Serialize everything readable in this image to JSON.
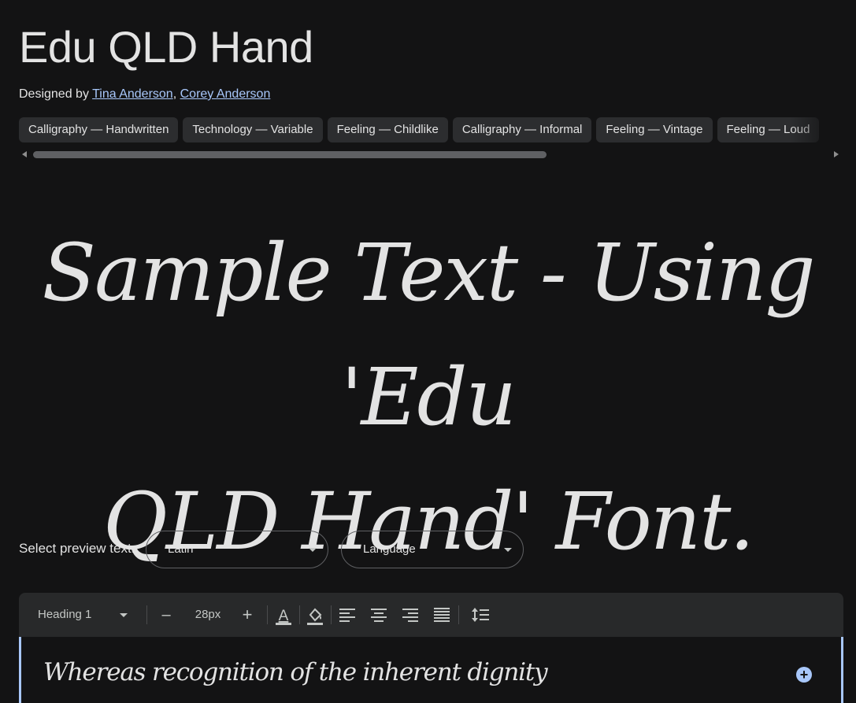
{
  "font": {
    "name": "Edu QLD Hand",
    "designed_by_label": "Designed by",
    "designers": [
      "Tina Anderson",
      "Corey Anderson"
    ],
    "designer_separator": ","
  },
  "tags": [
    "Calligraphy — Handwritten",
    "Technology — Variable",
    "Feeling — Childlike",
    "Calligraphy — Informal",
    "Feeling — Vintage",
    "Feeling — Loud"
  ],
  "sample": {
    "line1": "Sample Text - Using 'Edu",
    "line2": "QLD Hand' Font."
  },
  "preview": {
    "label": "Select preview text:",
    "script_value": "Latin",
    "language_value": "Language"
  },
  "toolbar": {
    "style_value": "Heading 1",
    "decrease_label": "–",
    "size_value": "28px",
    "increase_label": "+",
    "icons": [
      "text-color-icon",
      "fill-color-icon",
      "align-left-icon",
      "align-center-icon",
      "align-right-icon",
      "align-justify-icon",
      "line-height-icon"
    ]
  },
  "editor": {
    "text": "Whereas recognition of the inherent dignity"
  },
  "colors": {
    "background": "#131314",
    "text": "#e3e3e3",
    "link": "#a8c7fa",
    "chip": "#2c2d2f",
    "toolbar": "#28292a",
    "accent": "#a8c7fa"
  }
}
